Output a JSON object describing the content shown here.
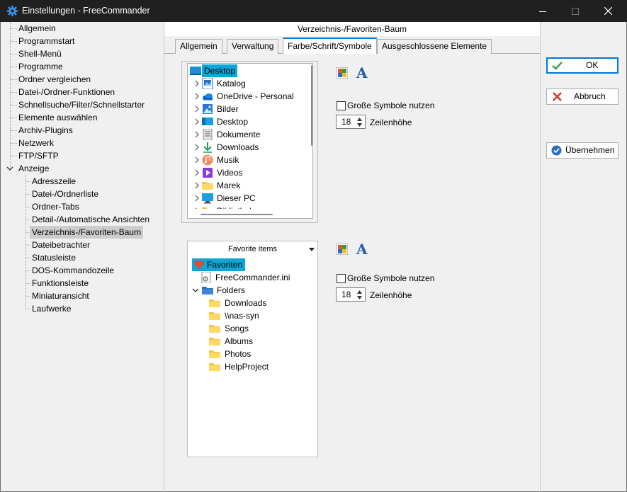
{
  "window": {
    "title": "Einstellungen - FreeCommander",
    "icon": "gear-icon",
    "controls": [
      "minimize-icon",
      "maximize-icon",
      "close-icon"
    ]
  },
  "nav": {
    "items": [
      {
        "label": "Allgemein"
      },
      {
        "label": "Programmstart"
      },
      {
        "label": "Shell-Menü"
      },
      {
        "label": "Programme"
      },
      {
        "label": "Ordner vergleichen"
      },
      {
        "label": "Datei-/Ordner-Funktionen"
      },
      {
        "label": "Schnellsuche/Filter/Schnellstarter"
      },
      {
        "label": "Elemente auswählen"
      },
      {
        "label": "Archiv-Plugins"
      },
      {
        "label": "Netzwerk"
      },
      {
        "label": "FTP/SFTP"
      },
      {
        "label": "Anzeige"
      }
    ],
    "children": [
      {
        "label": "Adresszeile"
      },
      {
        "label": "Datei-/Ordnerliste"
      },
      {
        "label": "Ordner-Tabs"
      },
      {
        "label": "Detail-/Automatische Ansichten"
      },
      {
        "label": "Verzeichnis-/Favoriten-Baum"
      },
      {
        "label": "Dateibetrachter"
      },
      {
        "label": "Statusleiste"
      },
      {
        "label": "DOS-Kommandozeile"
      },
      {
        "label": "Funktionsleiste"
      },
      {
        "label": "Miniaturansicht"
      },
      {
        "label": "Laufwerke"
      }
    ],
    "selected": "Verzeichnis-/Favoriten-Baum"
  },
  "header": {
    "title": "Verzeichnis-/Favoriten-Baum"
  },
  "tabs": [
    {
      "label": "Allgemein"
    },
    {
      "label": "Verwaltung"
    },
    {
      "label": "Farbe/Schrift/Symbole"
    },
    {
      "label": "Ausgeschlossene Elemente"
    }
  ],
  "active_tab": "Farbe/Schrift/Symbole",
  "folder_tree": {
    "items": [
      {
        "label": "Desktop",
        "icon": "desktop-icon"
      },
      {
        "label": "Katalog",
        "icon": "catalog-icon"
      },
      {
        "label": "OneDrive - Personal",
        "icon": "onedrive-icon"
      },
      {
        "label": "Bilder",
        "icon": "pictures-icon"
      },
      {
        "label": "Desktop",
        "icon": "desktop-folder-icon"
      },
      {
        "label": "Dokumente",
        "icon": "documents-icon"
      },
      {
        "label": "Downloads",
        "icon": "downloads-icon"
      },
      {
        "label": "Musik",
        "icon": "music-icon"
      },
      {
        "label": "Videos",
        "icon": "videos-icon"
      },
      {
        "label": "Marek",
        "icon": "folder-icon"
      },
      {
        "label": "Dieser PC",
        "icon": "pc-icon"
      },
      {
        "label": "Bibliotheken",
        "icon": "libraries-icon"
      }
    ]
  },
  "favorites": {
    "combo_label": "Favorite items",
    "items": [
      {
        "label": "Favoriten",
        "icon": "heart-icon"
      },
      {
        "label": "FreeCommander.ini",
        "icon": "ini-file-icon"
      },
      {
        "label": "Folders",
        "icon": "blue-folder-icon"
      },
      {
        "label": "Downloads",
        "icon": "folder-icon"
      },
      {
        "label": "\\\\nas-syn",
        "icon": "folder-icon"
      },
      {
        "label": "Songs",
        "icon": "folder-icon"
      },
      {
        "label": "Albums",
        "icon": "folder-icon"
      },
      {
        "label": "Photos",
        "icon": "folder-icon"
      },
      {
        "label": "HelpProject",
        "icon": "folder-icon"
      }
    ]
  },
  "options_top": {
    "large_icons_label": "Große Symbole nutzen",
    "large_icons_checked": false,
    "row_height_value": "18",
    "row_height_label": "Zeilenhöhe"
  },
  "options_bottom": {
    "large_icons_label": "Große Symbole nutzen",
    "large_icons_checked": false,
    "row_height_value": "18",
    "row_height_label": "Zeilenhöhe"
  },
  "color_icon": "color-palette-icon",
  "font_icon_glyph": "A",
  "buttons": {
    "ok": "OK",
    "cancel": "Abbruch",
    "apply": "Übernehmen"
  },
  "colors": {
    "accent": "#0078d7",
    "selection": "#0ea5d8",
    "folder": "#f6c443",
    "titlebar": "#202020"
  }
}
